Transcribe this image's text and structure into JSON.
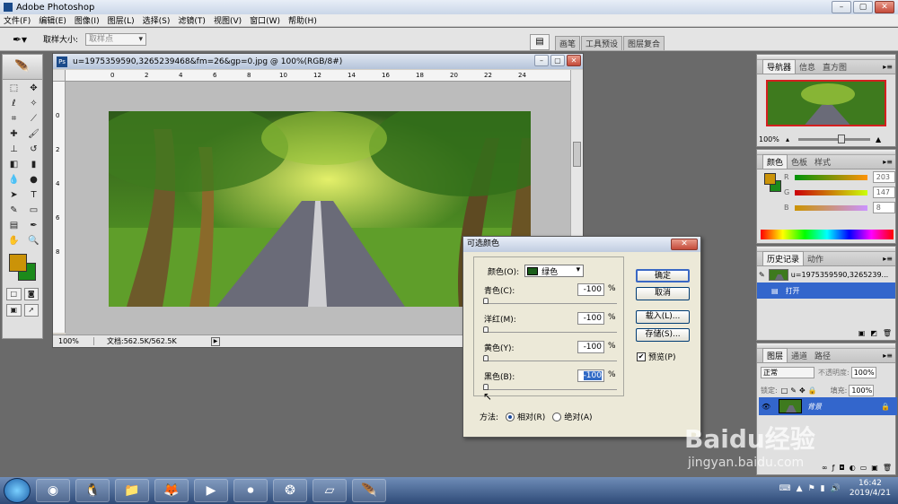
{
  "app": {
    "title": "Adobe Photoshop"
  },
  "menu": [
    "文件(F)",
    "编辑(E)",
    "图像(I)",
    "图层(L)",
    "选择(S)",
    "滤镜(T)",
    "视图(V)",
    "窗口(W)",
    "帮助(H)"
  ],
  "options": {
    "sample_size_label": "取样大小:",
    "sample_size_value": "取样点",
    "well_tabs": [
      "画笔",
      "工具预设",
      "图层复合"
    ]
  },
  "document": {
    "title": "u=1975359590,3265239468&fm=26&gp=0.jpg @ 100%(RGB/8#)",
    "ruler_top": [
      "0",
      "2",
      "4",
      "6",
      "8",
      "10",
      "12",
      "14",
      "16",
      "18",
      "20",
      "22",
      "24"
    ],
    "ruler_left": [
      "0",
      "2",
      "4",
      "6",
      "8"
    ],
    "zoom": "100%",
    "doc_info": "文档:562.5K/562.5K"
  },
  "navigator": {
    "tabs": [
      "导航器",
      "信息",
      "直方图"
    ],
    "zoom": "100%"
  },
  "color_panel": {
    "tabs": [
      "颜色",
      "色板",
      "样式"
    ],
    "channels": [
      {
        "name": "R",
        "value": "203"
      },
      {
        "name": "G",
        "value": "147"
      },
      {
        "name": "B",
        "value": "8"
      }
    ],
    "fg_color": "#cb9308",
    "bg_color": "#1b8a1b"
  },
  "history_panel": {
    "tabs": [
      "历史记录",
      "动作"
    ],
    "snapshot": "u=1975359590,3265239...",
    "step": "打开"
  },
  "layers_panel": {
    "tabs": [
      "图层",
      "通道",
      "路径"
    ],
    "blend_mode": "正常",
    "opacity_label": "不透明度:",
    "opacity": "100%",
    "lock_label": "锁定:",
    "fill_label": "填充:",
    "fill": "100%",
    "layer_name": "背景"
  },
  "dialog": {
    "title": "可选颜色",
    "color_label": "颜色(O):",
    "color_value": "绿色",
    "sliders": [
      {
        "label": "青色(C):",
        "value": "-100",
        "unit": "%"
      },
      {
        "label": "洋红(M):",
        "value": "-100",
        "unit": "%"
      },
      {
        "label": "黄色(Y):",
        "value": "-100",
        "unit": "%"
      },
      {
        "label": "黑色(B):",
        "value": "-100",
        "unit": "%"
      }
    ],
    "buttons": {
      "ok": "确定",
      "cancel": "取消",
      "load": "载入(L)...",
      "save": "存储(S)..."
    },
    "preview_label": "预览(P)",
    "method_label": "方法:",
    "method_relative": "相对(R)",
    "method_absolute": "绝对(A)"
  },
  "taskbar": {
    "time": "16:42",
    "date": "2019/4/21"
  },
  "watermark": {
    "brand": "Baidu经验",
    "url": "jingyan.baidu.com"
  }
}
